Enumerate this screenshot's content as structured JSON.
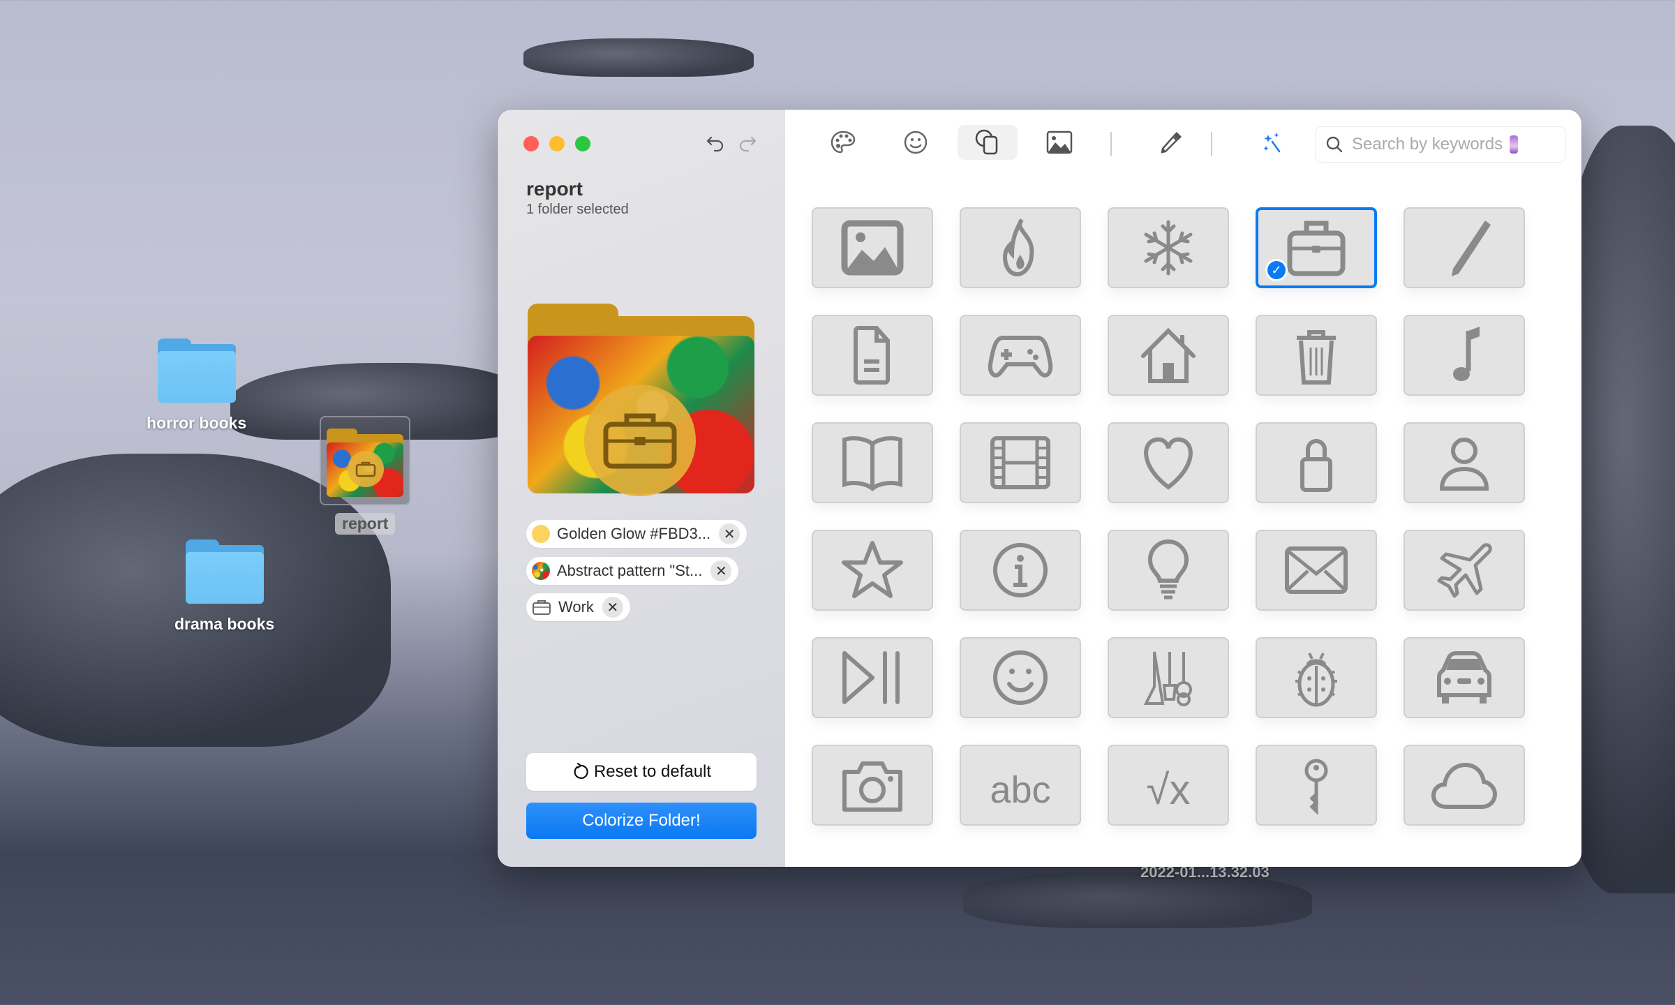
{
  "desktop": {
    "icons": [
      {
        "label": "horror books"
      },
      {
        "label": "drama books"
      },
      {
        "label": "report"
      }
    ],
    "screenshot_label": "2022-01...13.32.03"
  },
  "window": {
    "folder_name": "report",
    "selection_status": "1 folder selected",
    "applied": [
      {
        "label": "Golden Glow #FBD3...",
        "kind": "color",
        "color": "#FBD35E"
      },
      {
        "label": "Abstract pattern \"St...",
        "kind": "pattern"
      },
      {
        "label": "Work",
        "kind": "emblem"
      }
    ],
    "reset_label": "Reset to default",
    "colorize_label": "Colorize Folder!",
    "accent_color": "#0A7BF3"
  },
  "toolbar": {
    "tabs": [
      {
        "name": "colors",
        "icon": "palette-icon",
        "active": false
      },
      {
        "name": "emoji",
        "icon": "smiley-icon",
        "active": false
      },
      {
        "name": "symbols",
        "icon": "shapes-icon",
        "active": true
      },
      {
        "name": "images",
        "icon": "photo-icon",
        "active": false
      },
      {
        "name": "eyedropper",
        "icon": "eyedropper-icon",
        "active": false
      },
      {
        "name": "magic",
        "icon": "sparkles-icon",
        "active": false
      }
    ],
    "search_placeholder": "Search by keywords"
  },
  "symbols": [
    {
      "name": "photo"
    },
    {
      "name": "flame"
    },
    {
      "name": "snowflake"
    },
    {
      "name": "briefcase",
      "selected": true
    },
    {
      "name": "pencil"
    },
    {
      "name": "document"
    },
    {
      "name": "gamecontroller"
    },
    {
      "name": "house"
    },
    {
      "name": "trash"
    },
    {
      "name": "music-note"
    },
    {
      "name": "book"
    },
    {
      "name": "film"
    },
    {
      "name": "heart"
    },
    {
      "name": "lock"
    },
    {
      "name": "person"
    },
    {
      "name": "star"
    },
    {
      "name": "info"
    },
    {
      "name": "lightbulb"
    },
    {
      "name": "envelope"
    },
    {
      "name": "airplane"
    },
    {
      "name": "play-pause"
    },
    {
      "name": "smiley"
    },
    {
      "name": "guitars"
    },
    {
      "name": "ladybug"
    },
    {
      "name": "car"
    },
    {
      "name": "camera"
    },
    {
      "name": "abc",
      "text": "abc"
    },
    {
      "name": "square-root",
      "text": "√x"
    },
    {
      "name": "key"
    },
    {
      "name": "cloud"
    }
  ]
}
